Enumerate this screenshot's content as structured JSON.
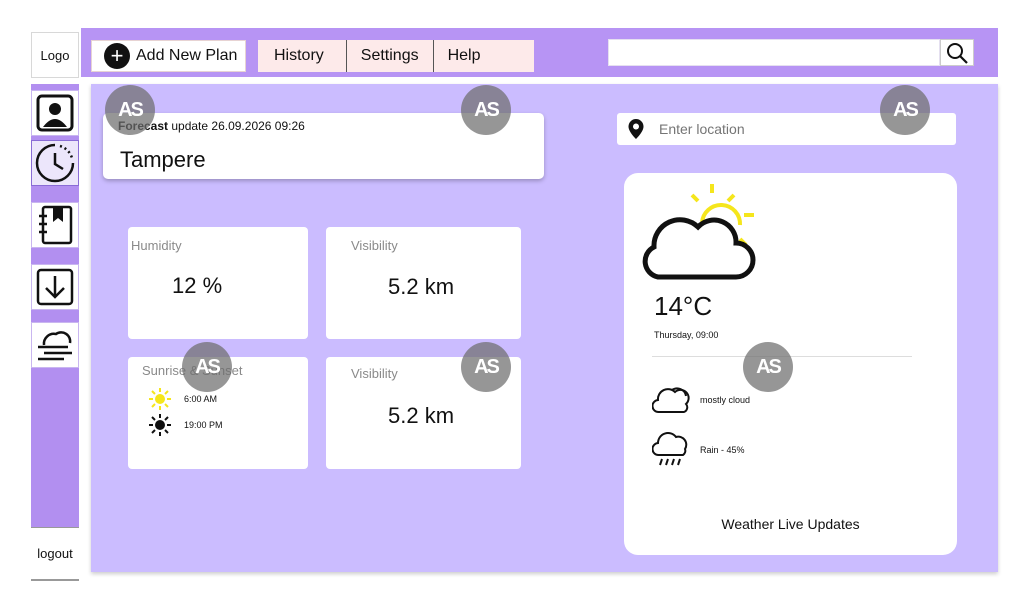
{
  "sidebar": {
    "logo": "Logo",
    "logout": "logout",
    "items": [
      {
        "icon": "profile-icon"
      },
      {
        "icon": "clock-icon"
      },
      {
        "icon": "notebook-bookmark-icon"
      },
      {
        "icon": "download-icon"
      },
      {
        "icon": "wind-weather-icon"
      }
    ]
  },
  "topbar": {
    "add_plan": "Add New Plan",
    "nav": [
      "History",
      "Settings",
      "Help"
    ],
    "search_placeholder": "",
    "search_icon": "search-icon"
  },
  "forecast": {
    "label_bold": "Forecast",
    "label_rest": " update 26.09.2026 09:26",
    "city": "Tampere"
  },
  "stats": {
    "humidity": {
      "label": "Humidity",
      "value": "12 %"
    },
    "visibility_1": {
      "label": "Visibility",
      "value": "5.2 km"
    },
    "sun": {
      "label": "Sunrise & Sunset",
      "sunrise": "6:00 AM",
      "sunset": "19:00 PM"
    },
    "visibility_2": {
      "label": "Visibility",
      "value": "5.2 km"
    }
  },
  "location": {
    "placeholder": "Enter location"
  },
  "weather": {
    "temp": "14°C",
    "daytime": "Thursday, 09:00",
    "conditions": [
      {
        "icon": "cloud-icon",
        "text": "mostly cloud"
      },
      {
        "icon": "rain-cloud-icon",
        "text": "Rain - 45%"
      }
    ],
    "footer": "Weather Live Updates"
  },
  "watermark": "AS",
  "colors": {
    "accent": "#b794f4",
    "panel": "#cbbcff",
    "sun": "#f5e61c"
  }
}
